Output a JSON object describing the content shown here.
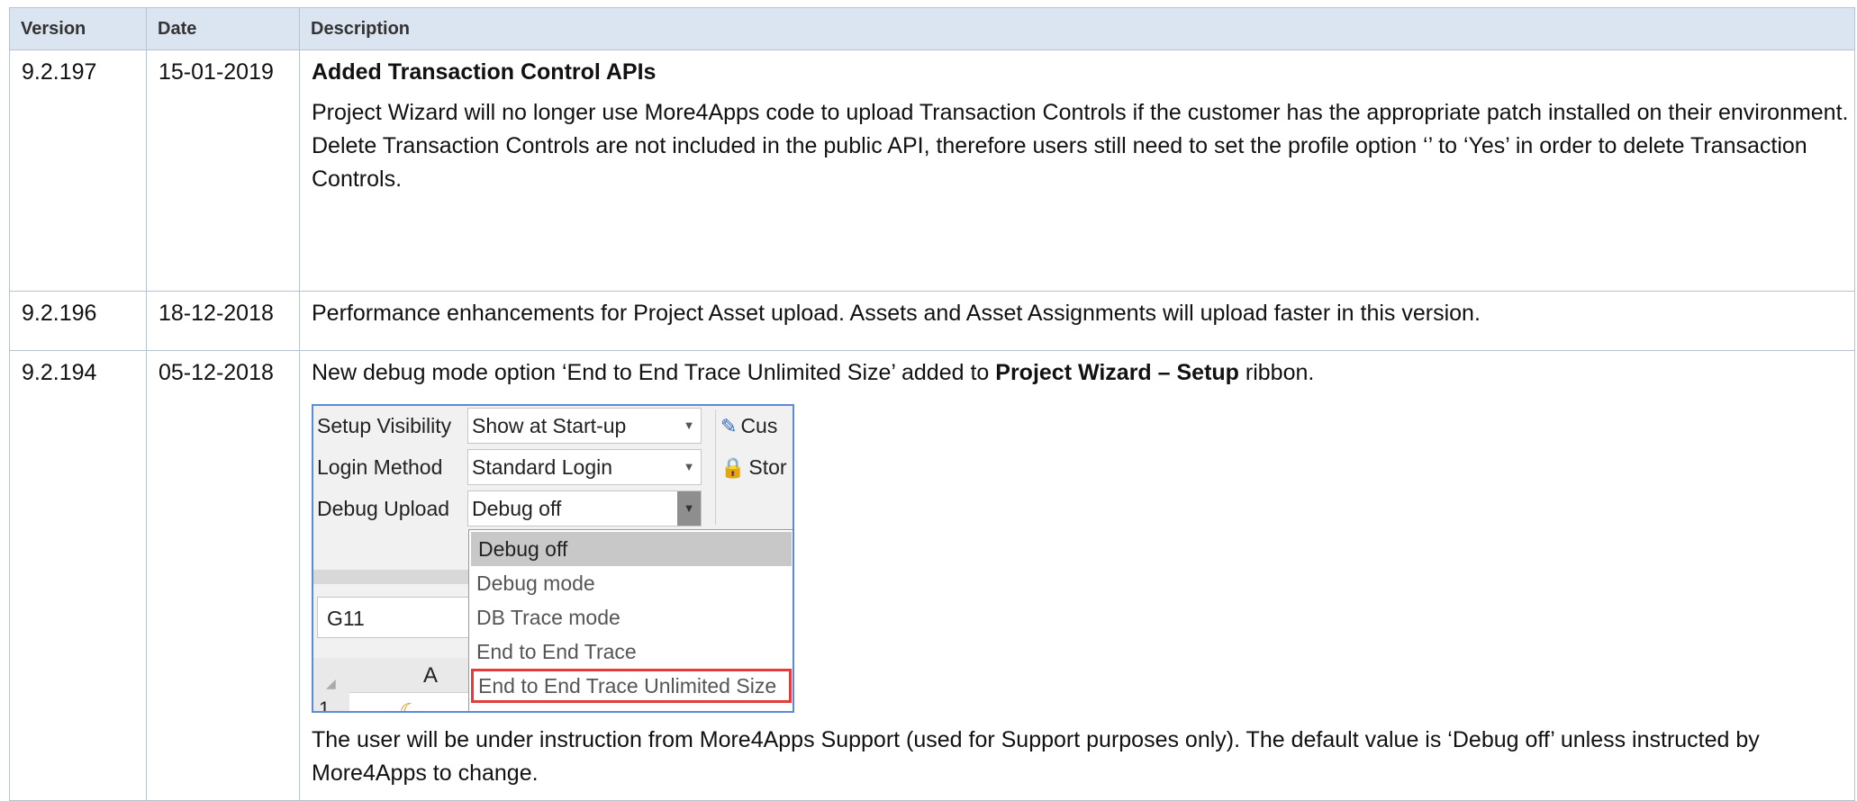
{
  "table": {
    "headers": {
      "version": "Version",
      "date": "Date",
      "description": "Description"
    },
    "rows": [
      {
        "version": "9.2.197",
        "date": "15-01-2019",
        "title": "Added Transaction Control APIs",
        "text": "Project Wizard will no longer use More4Apps code to upload Transaction Controls if the customer has the appropriate patch installed on their environment.  Delete Transaction Controls are not included in the public API, therefore users still need to set the profile option ‘’ to ‘Yes’ in order to delete Transaction Controls."
      },
      {
        "version": "9.2.196",
        "date": "18-12-2018",
        "text": "Performance enhancements for Project Asset upload.  Assets and Asset Assignments will upload faster in this version."
      },
      {
        "version": "9.2.194",
        "date": "05-12-2018",
        "intro_before": "New debug mode option ‘End to End Trace Unlimited Size’ added to ",
        "intro_bold": "Project Wizard – Setup",
        "intro_after": " ribbon.",
        "outro": "The user will be under instruction from More4Apps Support (used for Support purposes only).  The default value is ‘Debug off’ unless instructed by More4Apps to change."
      }
    ]
  },
  "ribbon": {
    "setup_visibility_label": "Setup Visibility",
    "setup_visibility_value": "Show at Start-up",
    "login_method_label": "Login Method",
    "login_method_value": "Standard Login",
    "debug_upload_label": "Debug Upload",
    "debug_upload_value": "Debug off",
    "side_button_1": "Cus",
    "side_button_2": "Stor",
    "name_box": "G11",
    "column_header": "A",
    "row_header": "1",
    "dropdown_options": [
      "Debug off",
      "Debug mode",
      "DB Trace mode",
      "End to End Trace",
      "End to End Trace Unlimited Size"
    ],
    "highlight_color": "#e63b3b"
  }
}
